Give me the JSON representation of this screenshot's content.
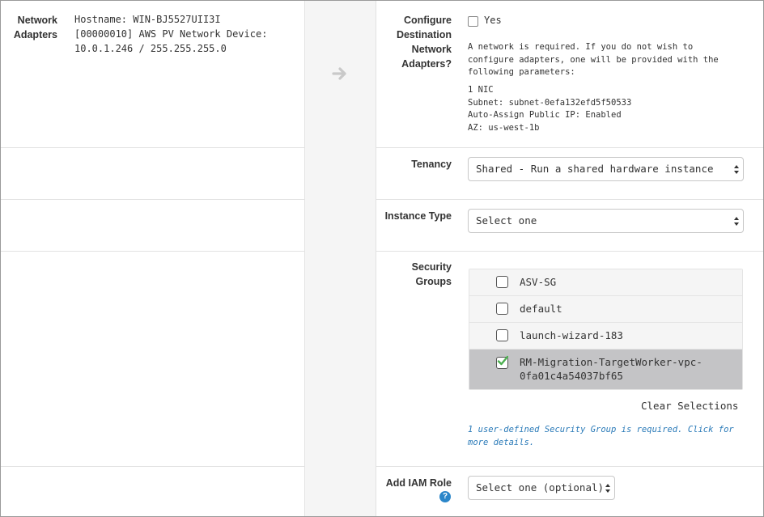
{
  "source": {
    "network_adapters_label": "Network Adapters",
    "network_adapters_lines": [
      "Hostname: WIN-BJ5527UII3I",
      "[00000010] AWS PV Network Device:",
      "10.0.1.246 / 255.255.255.0"
    ]
  },
  "destination": {
    "configure_adapters": {
      "label": "Configure Destination Network Adapters?",
      "checkbox_label": "Yes",
      "checked": false,
      "note_lines": [
        "A network is required. If you do not wish to",
        "configure adapters, one will be provided with the",
        "following parameters:"
      ],
      "param_lines": [
        "1 NIC",
        "Subnet: subnet-0efa132efd5f50533",
        "Auto-Assign Public IP: Enabled",
        "AZ: us-west-1b"
      ]
    },
    "tenancy": {
      "label": "Tenancy",
      "value": "Shared - Run a shared hardware instance"
    },
    "instance_type": {
      "label": "Instance Type",
      "value": "Select one"
    },
    "security_groups": {
      "label": "Security Groups",
      "items": [
        {
          "name": "ASV-SG",
          "checked": false
        },
        {
          "name": "default",
          "checked": false
        },
        {
          "name": "launch-wizard-183",
          "checked": false
        },
        {
          "name": "RM-Migration-TargetWorker-vpc-\n0fa01c4a54037bf65",
          "checked": true
        }
      ],
      "clear_label": "Clear Selections",
      "info_lines": [
        "1 user-defined Security Group is required. Click for",
        "more details."
      ]
    },
    "iam_role": {
      "label": "Add IAM Role",
      "value": "Select one (optional)"
    }
  },
  "colors": {
    "check_green": "#4caf50",
    "link_blue": "#2a7ab8",
    "help_blue": "#2b86c9",
    "selected_row": "#c4c4c6"
  }
}
